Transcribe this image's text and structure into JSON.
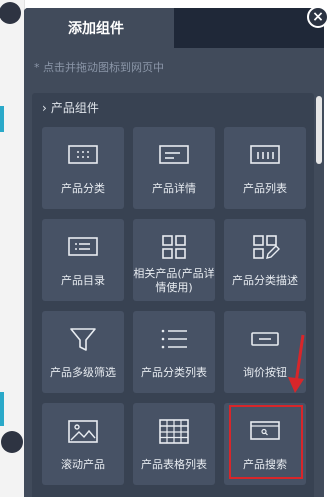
{
  "panel": {
    "title": "添加组件",
    "close_icon": "×",
    "hint": "* 点击并拖动图标到网页中"
  },
  "section": {
    "title": "产品组件",
    "chevron": "›"
  },
  "tiles": [
    {
      "label": "产品分类",
      "icon": "product-category-icon"
    },
    {
      "label": "产品详情",
      "icon": "product-detail-icon"
    },
    {
      "label": "产品列表",
      "icon": "product-list-icon"
    },
    {
      "label": "产品目录",
      "icon": "product-catalog-icon"
    },
    {
      "label": "相关产品(产品详情使用)",
      "icon": "related-products-icon"
    },
    {
      "label": "产品分类描述",
      "icon": "category-description-icon"
    },
    {
      "label": "产品多级筛选",
      "icon": "filter-icon"
    },
    {
      "label": "产品分类列表",
      "icon": "category-list-icon"
    },
    {
      "label": "询价按钮",
      "icon": "inquiry-button-icon"
    },
    {
      "label": "滚动产品",
      "icon": "scrolling-products-icon"
    },
    {
      "label": "产品表格列表",
      "icon": "product-table-icon"
    },
    {
      "label": "产品搜索",
      "icon": "product-search-icon"
    }
  ],
  "colors": {
    "highlight": "#d8262a",
    "accent": "#2aa9c9"
  }
}
